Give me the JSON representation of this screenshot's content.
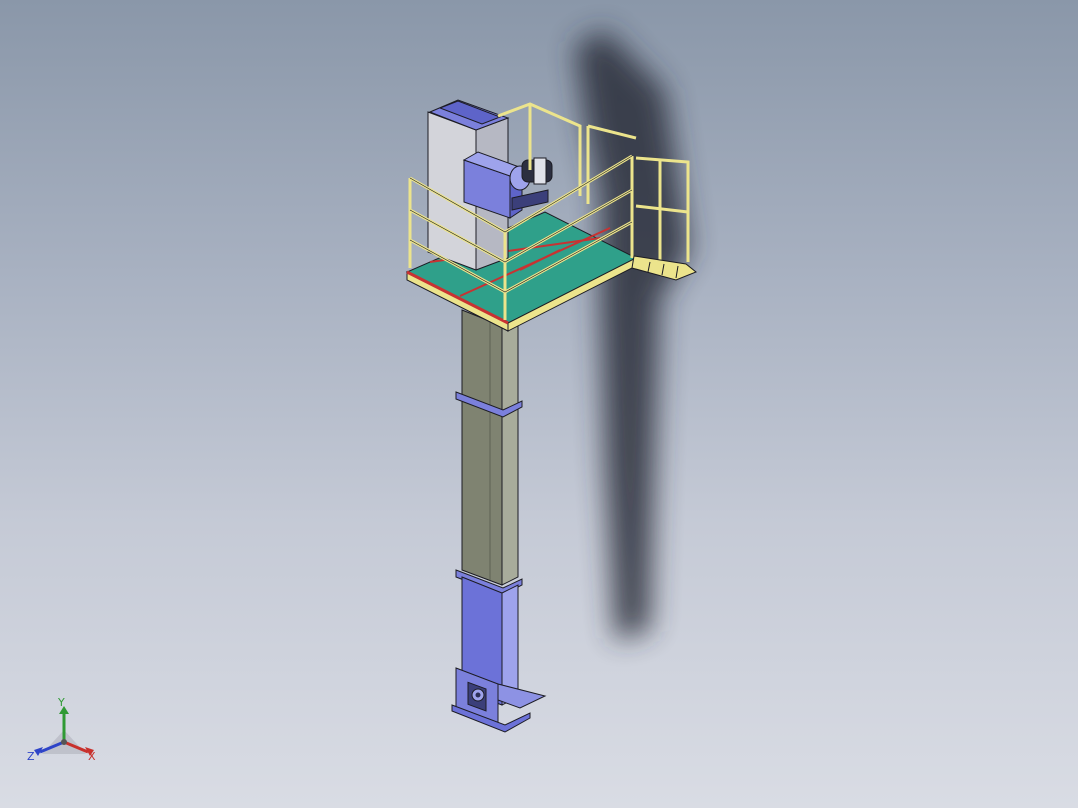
{
  "viewport": {
    "background_top": "#8a97a9",
    "background_bottom": "#d9dce4"
  },
  "model": {
    "name": "bucket-elevator-assembly",
    "colors": {
      "casing_body": "#7f8371",
      "casing_lower": "#6c72d8",
      "drive_housing": "#7b80dc",
      "railing": "#ece48c",
      "platform_floor": "#2fa08a",
      "platform_beam": "#c83232",
      "shadow": "#2a2f3a"
    }
  },
  "triad": {
    "x_label": "X",
    "y_label": "Y",
    "z_label": "Z",
    "x_color": "#c8302c",
    "y_color": "#2f9a34",
    "z_color": "#2e44c8"
  }
}
